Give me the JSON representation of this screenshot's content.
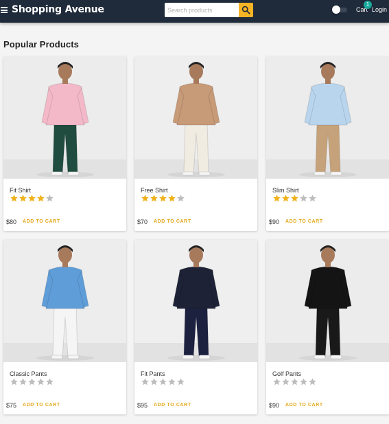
{
  "header": {
    "brand": "Shopping Avenue",
    "search": {
      "placeholder": "Search products",
      "value": ""
    },
    "cart_label": "Cart",
    "cart_count": "1",
    "login_label": "Login",
    "theme_toggle_on": false
  },
  "section_title": "Popular Products",
  "products": [
    {
      "name": "Fit Shirt",
      "rating": 4,
      "max_rating": 5,
      "price": "$80",
      "cta": "ADD TO CART",
      "shirt": "#f3b9c9",
      "pants": "#1f4c3f",
      "bg": "#ececec"
    },
    {
      "name": "Free Shirt",
      "rating": 4,
      "max_rating": 5,
      "price": "$70",
      "cta": "ADD TO CART",
      "shirt": "#c79a78",
      "pants": "#f1ece2",
      "bg": "#eeeeee"
    },
    {
      "name": "Slim Shirt",
      "rating": 3,
      "max_rating": 5,
      "price": "$90",
      "cta": "ADD TO CART",
      "shirt": "#b9d5ee",
      "pants": "#c6a27a",
      "bg": "#ececec"
    },
    {
      "name": "Classic Pants",
      "rating": 0,
      "max_rating": 5,
      "price": "$75",
      "cta": "ADD TO CART",
      "shirt": "#5f9dd8",
      "pants": "#f5f5f5",
      "bg": "#ededed"
    },
    {
      "name": "Fit Pants",
      "rating": 0,
      "max_rating": 5,
      "price": "$95",
      "cta": "ADD TO CART",
      "shirt": "#1d2236",
      "pants": "#1c2140",
      "bg": "#efefef"
    },
    {
      "name": "Golf Pants",
      "rating": 0,
      "max_rating": 5,
      "price": "$90",
      "cta": "ADD TO CART",
      "shirt": "#141414",
      "pants": "#191919",
      "bg": "#ececec"
    }
  ],
  "colors": {
    "appbar": "#1f2a3a",
    "accent": "#f6b325",
    "star_filled": "#f0b21b",
    "star_empty": "#bdbdbd",
    "badge": "#18a99b"
  }
}
